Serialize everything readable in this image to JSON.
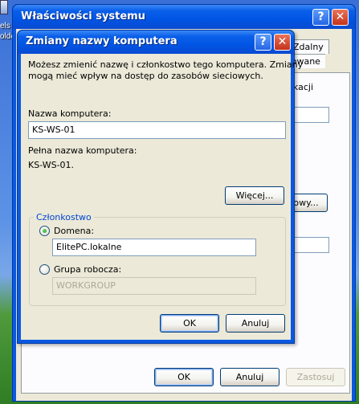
{
  "desktop": {
    "partial_texts": [
      "els S",
      "olde"
    ]
  },
  "back_window": {
    "title": "Właściwości systemu",
    "tabs": [
      "Zdalny",
      "sowane"
    ],
    "panel_texts": [
      "fikacji",
      "owy..."
    ],
    "buttons": {
      "ok": "OK",
      "cancel": "Anuluj",
      "apply": "Zastosuj"
    }
  },
  "dialog": {
    "title": "Zmiany nazwy komputera",
    "help_glyph": "?",
    "close_glyph": "✕",
    "description": [
      "Możesz zmienić nazwę i członkostwo tego komputera. Zmiany",
      "mogą mieć wpływ na dostęp do zasobów sieciowych."
    ],
    "computer_name_label": "Nazwa komputera:",
    "computer_name_value": "KS-WS-01",
    "full_name_label": "Pełna nazwa komputera:",
    "full_name_value": "KS-WS-01.",
    "more_button": "Więcej...",
    "membership": {
      "group_label": "Członkostwo",
      "domain_label": "Domena:",
      "domain_value": "ElitePC.lokalne",
      "domain_selected": true,
      "workgroup_label": "Grupa robocza:",
      "workgroup_value": "WORKGROUP",
      "workgroup_selected": false
    },
    "buttons": {
      "ok": "OK",
      "cancel": "Anuluj"
    }
  }
}
